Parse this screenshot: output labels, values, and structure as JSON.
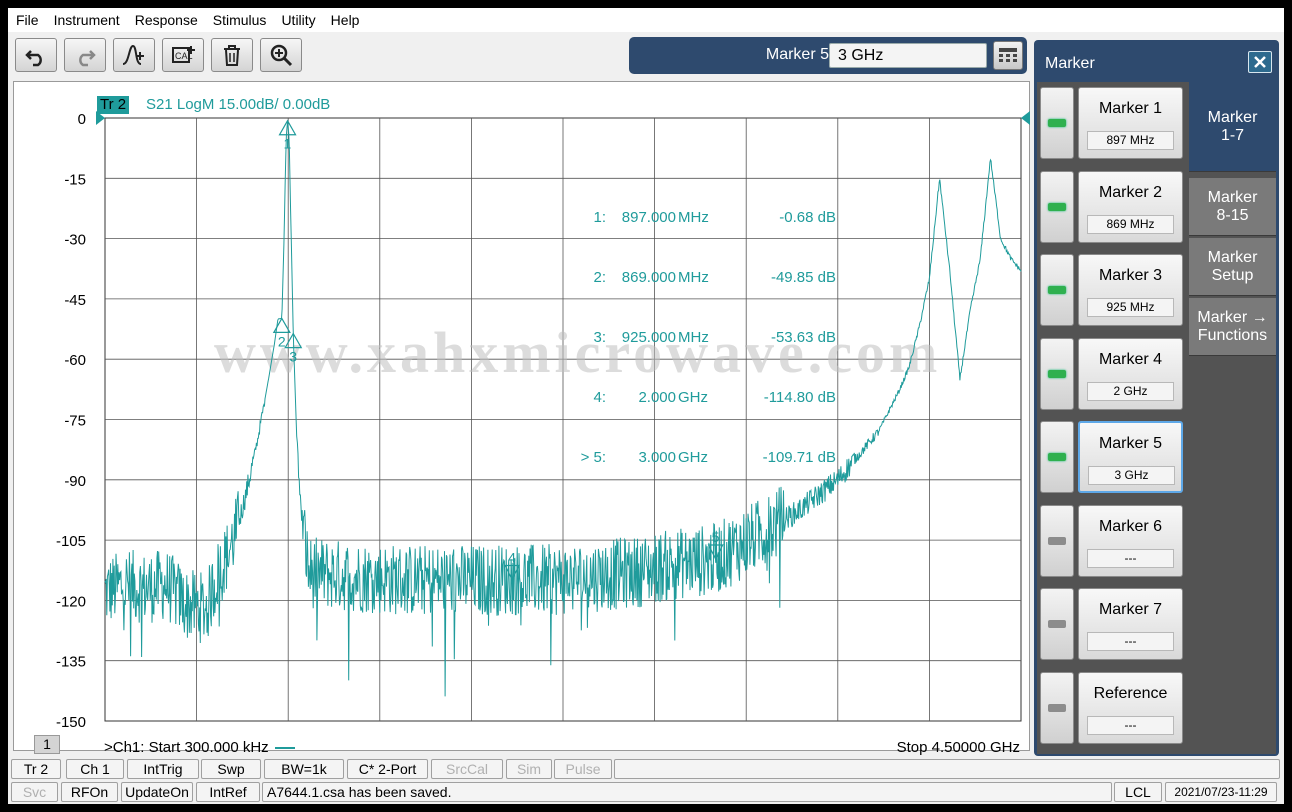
{
  "menu": [
    "File",
    "Instrument",
    "Response",
    "Stimulus",
    "Utility",
    "Help"
  ],
  "toolbar": {
    "buttons": [
      "undo-icon",
      "redo-icon",
      "marker-add-icon",
      "cal-add-icon",
      "trash-icon",
      "zoom-in-icon"
    ]
  },
  "marker_entry": {
    "label": "Marker 5",
    "value": "3 GHz"
  },
  "trace": {
    "badge": "Tr 2",
    "title": "S21 LogM 15.00dB/  0.00dB",
    "color": "#1f9b9b"
  },
  "watermark": "www.xahxmicrowave.com",
  "channel": {
    "number": "1",
    "start": ">Ch1:  Start  300.000 kHz",
    "stop": "Stop  4.50000 GHz"
  },
  "marker_table": [
    {
      "id": "1:",
      "freq": "897.000",
      "unit": "MHz",
      "value": "-0.68 dB"
    },
    {
      "id": "2:",
      "freq": "869.000",
      "unit": "MHz",
      "value": "-49.85 dB"
    },
    {
      "id": "3:",
      "freq": "925.000",
      "unit": "MHz",
      "value": "-53.63 dB"
    },
    {
      "id": "4:",
      "freq": "2.000",
      "unit": "GHz",
      "value": "-114.80 dB"
    },
    {
      "id": "> 5:",
      "freq": "3.000",
      "unit": "GHz",
      "value": "-109.71 dB"
    }
  ],
  "chart_data": {
    "type": "line",
    "xlim": [
      0.0003,
      4.5
    ],
    "ylim": [
      -150,
      0
    ],
    "y_ticks": [
      "0",
      "-15",
      "-30",
      "-45",
      "-60",
      "-75",
      "-90",
      "-105",
      "-120",
      "-135",
      "-150"
    ],
    "grid": true,
    "series": [
      {
        "x": [
          0.0003,
          0.1,
          0.2,
          0.3,
          0.4,
          0.5,
          0.55,
          0.6,
          0.65,
          0.7,
          0.75,
          0.8,
          0.83,
          0.85,
          0.869,
          0.88,
          0.89,
          0.897,
          0.905,
          0.915,
          0.925,
          0.94,
          0.96,
          0.98,
          1.0,
          1.2,
          1.5,
          1.8,
          2.0,
          2.2,
          2.4,
          2.6,
          2.8,
          3.0,
          3.2,
          3.4,
          3.6,
          3.8,
          3.9,
          3.95,
          4.0,
          4.05,
          4.1,
          4.15,
          4.2,
          4.25,
          4.3,
          4.35,
          4.4,
          4.45,
          4.5
        ],
        "y": [
          -118,
          -116,
          -117,
          -116,
          -121,
          -122,
          -114,
          -109,
          -102,
          -92,
          -80,
          -66,
          -57,
          -50,
          -49.85,
          -30,
          -5,
          -0.68,
          -5,
          -30,
          -53.63,
          -76,
          -96,
          -104,
          -113,
          -114,
          -115,
          -115,
          -114.8,
          -115,
          -114,
          -113,
          -111,
          -109.71,
          -104,
          -98,
          -90,
          -78,
          -68,
          -62,
          -52,
          -40,
          -15,
          -38,
          -65,
          -48,
          -35,
          -10,
          -30,
          -35,
          -38
        ]
      }
    ],
    "markers": [
      {
        "label": "1",
        "x": 0.897,
        "y": -0.68
      },
      {
        "label": "2",
        "x": 0.869,
        "y": -49.85
      },
      {
        "label": "3",
        "x": 0.925,
        "y": -53.63
      },
      {
        "label": "4",
        "x": 2.0,
        "y": -114.8
      },
      {
        "label": "5",
        "x": 3.0,
        "y": -109.71
      }
    ]
  },
  "panel": {
    "title": "Marker",
    "markers": [
      {
        "label": "Marker 1",
        "value": "897 MHz",
        "on": true
      },
      {
        "label": "Marker 2",
        "value": "869 MHz",
        "on": true
      },
      {
        "label": "Marker 3",
        "value": "925 MHz",
        "on": true
      },
      {
        "label": "Marker 4",
        "value": "2 GHz",
        "on": true
      },
      {
        "label": "Marker 5",
        "value": "3 GHz",
        "on": true
      },
      {
        "label": "Marker 6",
        "value": "---",
        "on": false
      },
      {
        "label": "Marker 7",
        "value": "---",
        "on": false
      },
      {
        "label": "Reference",
        "value": "---",
        "on": false
      }
    ],
    "tabs": [
      "Marker\n1-7",
      "Marker\n8-15",
      "Marker\nSetup",
      "Marker →\nFunctions"
    ]
  },
  "status_top": [
    "Tr 2",
    "Ch 1",
    "IntTrig",
    "Swp",
    "BW=1k",
    "C* 2-Port",
    "SrcCal",
    "Sim",
    "Pulse"
  ],
  "status_bottom": {
    "cells": [
      "Svc",
      "RFOn",
      "UpdateOn",
      "IntRef"
    ],
    "message": "A7644.1.csa has been saved.",
    "lcl": "LCL",
    "datetime": "2021/07/23-11:29"
  }
}
